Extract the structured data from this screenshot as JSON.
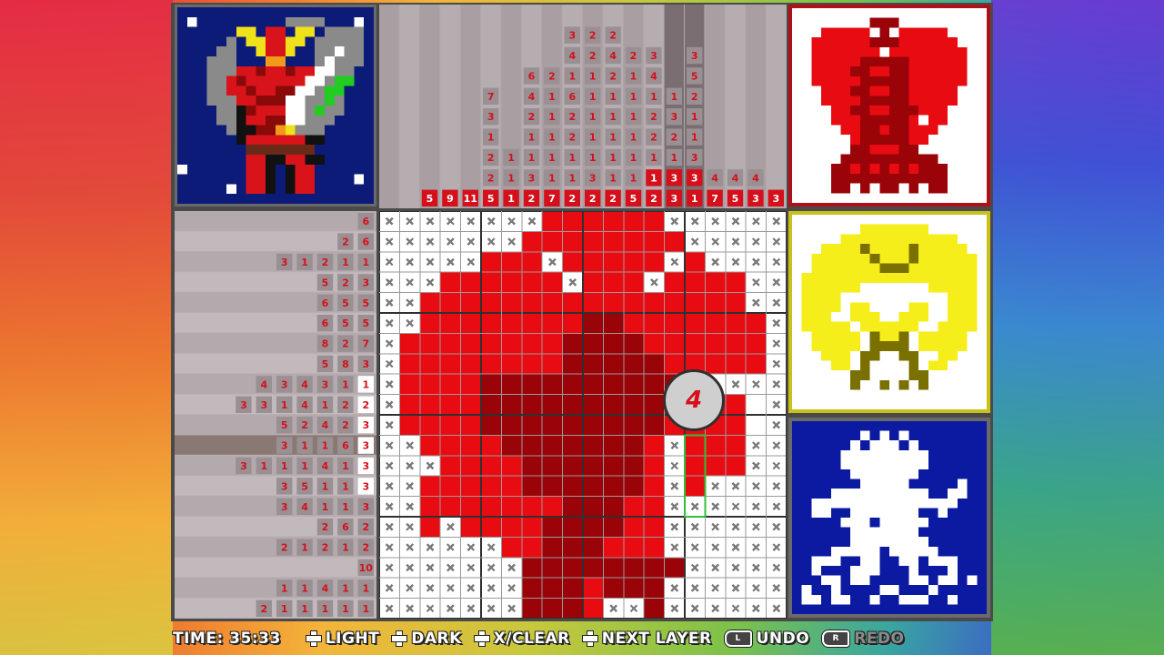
{
  "puzzle": {
    "size": 20,
    "layers": [
      "red",
      "yellow",
      "blue"
    ],
    "active_layer": "red",
    "hint_value": "4",
    "row_clues": [
      [
        "6"
      ],
      [
        "2",
        "6"
      ],
      [
        "3",
        "1",
        "2",
        "1",
        "1"
      ],
      [
        "5",
        "2",
        "3"
      ],
      [
        "6",
        "5",
        "5"
      ],
      [
        "6",
        "5",
        "5"
      ],
      [
        "8",
        "2",
        "7"
      ],
      [
        "5",
        "8",
        "3"
      ],
      [
        "4",
        "3",
        "4",
        "3",
        "1",
        "1"
      ],
      [
        "3",
        "3",
        "1",
        "4",
        "1",
        "2",
        "2"
      ],
      [
        "5",
        "2",
        "4",
        "2",
        "3"
      ],
      [
        "3",
        "1",
        "1",
        "6",
        "3"
      ],
      [
        "3",
        "1",
        "1",
        "1",
        "4",
        "1",
        "3"
      ],
      [
        "3",
        "5",
        "1",
        "1",
        "3"
      ],
      [
        "3",
        "4",
        "1",
        "1",
        "3"
      ],
      [
        "2",
        "6",
        "2"
      ],
      [
        "2",
        "1",
        "2",
        "1",
        "2"
      ],
      [
        "10"
      ],
      [
        "1",
        "1",
        "4",
        "1",
        "1"
      ],
      [
        "2",
        "1",
        "1",
        "1",
        "1",
        "1"
      ]
    ],
    "col_clues": [
      [],
      [],
      [
        "5"
      ],
      [
        "9"
      ],
      [
        "11"
      ],
      [
        "7",
        "3",
        "1",
        "2",
        "2",
        "5"
      ],
      [
        "1",
        "1",
        "1"
      ],
      [
        "6",
        "4",
        "2",
        "1",
        "1",
        "3",
        "2"
      ],
      [
        "2",
        "1",
        "1",
        "1",
        "1",
        "1",
        "7"
      ],
      [
        "3",
        "4",
        "1",
        "6",
        "2",
        "2",
        "1",
        "1",
        "2"
      ],
      [
        "2",
        "2",
        "1",
        "1",
        "1",
        "1",
        "1",
        "3",
        "2"
      ],
      [
        "2",
        "4",
        "2",
        "1",
        "1",
        "1",
        "1",
        "1",
        "2"
      ],
      [
        "2",
        "1",
        "1",
        "1",
        "1",
        "1",
        "1",
        "5"
      ],
      [
        "3",
        "4",
        "1",
        "2",
        "2",
        "1",
        "1",
        "2"
      ],
      [
        "1",
        "3",
        "2",
        "1",
        "3",
        "3"
      ],
      [
        "3",
        "5",
        "2",
        "1",
        "1",
        "3",
        "3",
        "1"
      ],
      [
        "4",
        "7"
      ],
      [
        "4",
        "5"
      ],
      [
        "4",
        "3"
      ],
      [
        "3"
      ]
    ],
    "highlight_rows": [
      8,
      9,
      10,
      11,
      12,
      13
    ],
    "highlight_cols": [
      14,
      15
    ]
  },
  "status": {
    "time_label": "TIME: 35:33"
  },
  "controls": {
    "light": "LIGHT",
    "dark": "DARK",
    "clear": "X/CLEAR",
    "next_layer": "NEXT LAYER",
    "undo_button": "L",
    "undo": "UNDO",
    "redo_button": "R",
    "redo": "REDO"
  },
  "icons": [
    "dpad-up-icon",
    "dpad-down-icon",
    "dpad-left-icon",
    "dpad-right-icon",
    "l-button-icon",
    "r-button-icon"
  ],
  "colors": {
    "red": "#e80c12",
    "dark_red": "#9a0308",
    "cross": "#7a7a7a",
    "yellow": "#f6ee1a",
    "olive": "#7a7000",
    "blue": "#0b1aa0"
  }
}
